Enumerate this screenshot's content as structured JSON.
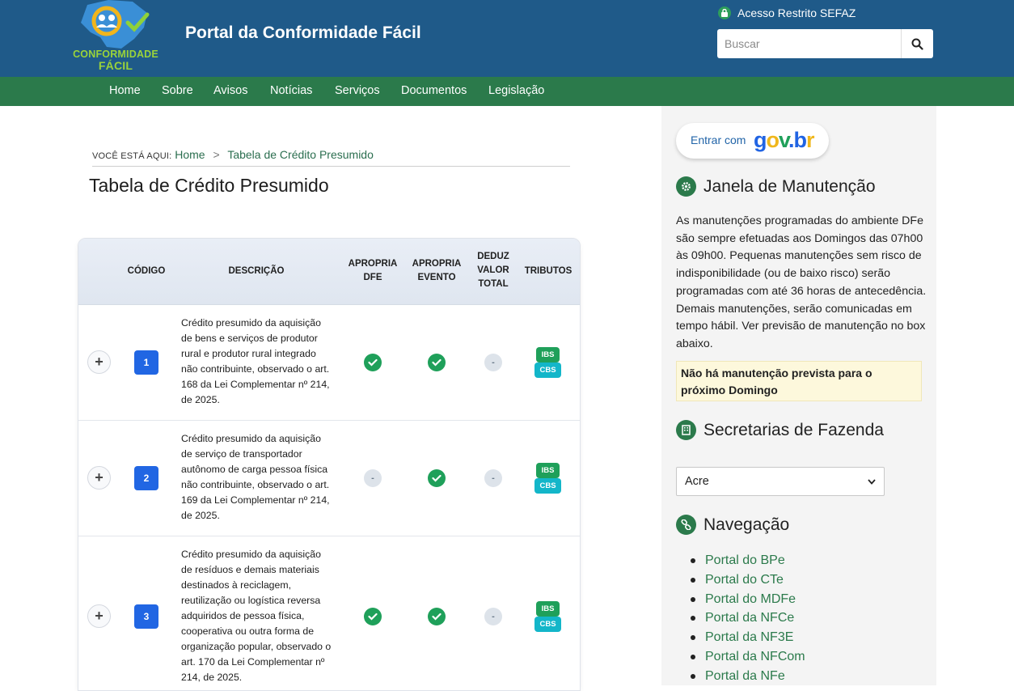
{
  "header": {
    "logo_text_1": "CONFORMIDADE",
    "logo_text_2": "FÁCIL",
    "site_title": "Portal da Conformidade Fácil",
    "restricted_label": "Acesso Restrito SEFAZ",
    "search_placeholder": "Buscar"
  },
  "nav": {
    "items": [
      "Home",
      "Sobre",
      "Avisos",
      "Notícias",
      "Serviços",
      "Documentos",
      "Legislação"
    ]
  },
  "breadcrumb": {
    "label": "VOCÊ ESTÁ AQUI:",
    "home": "Home",
    "separator": ">",
    "current": "Tabela de Crédito Presumido"
  },
  "page_title": "Tabela de Crédito Presumido",
  "table": {
    "headers": {
      "codigo": "CÓDIGO",
      "descricao": "DESCRIÇÃO",
      "apropria_dfe": "APROPRIA DFE",
      "apropria_evento": "APROPRIA EVENTO",
      "deduz_valor_total": "DEDUZ VALOR TOTAL",
      "tributos": "TRIBUTOS"
    },
    "expand_symbol": "+",
    "dash_symbol": "-",
    "rows": [
      {
        "code": "1",
        "description": "Crédito presumido da aquisição de bens e serviços de produtor rural e produtor rural integrado não contribuinte, observado o art. 168 da Lei Complementar nº 214, de 2025.",
        "apropria_dfe": true,
        "apropria_evento": true,
        "deduz_valor_total": false,
        "tributos": [
          "IBS",
          "CBS"
        ]
      },
      {
        "code": "2",
        "description": "Crédito presumido da aquisição de serviço de transportador autônomo de carga pessoa física não contribuinte, observado o art. 169 da Lei Complementar nº 214, de 2025.",
        "apropria_dfe": false,
        "apropria_evento": true,
        "deduz_valor_total": false,
        "tributos": [
          "IBS",
          "CBS"
        ]
      },
      {
        "code": "3",
        "description": "Crédito presumido da aquisição de resíduos e demais materiais destinados à reciclagem, reutilização ou logística reversa adquiridos de pessoa física, cooperativa ou outra forma de organização popular, observado o art. 170 da Lei Complementar nº 214, de 2025.",
        "apropria_dfe": true,
        "apropria_evento": true,
        "deduz_valor_total": false,
        "tributos": [
          "IBS",
          "CBS"
        ]
      }
    ]
  },
  "sidebar": {
    "govbr_label": "Entrar com",
    "govbr_logo": "gov.br",
    "maintenance": {
      "title": "Janela de Manutenção",
      "text": "As manutenções programadas do ambiente DFe são sempre efetuadas aos Domingos das 07h00 às 09h00. Pequenas manutenções sem risco de indisponibilidade (ou de baixo risco) serão programadas com até 36 horas de antecedência. Demais manutenções, serão comunicadas em tempo hábil. Ver previsão de manutenção no box abaixo.",
      "note": "Não há manutenção prevista para o próximo Domingo"
    },
    "secretarias": {
      "title": "Secretarias de Fazenda",
      "selected": "Acre"
    },
    "navegacao": {
      "title": "Navegação",
      "links": [
        "Portal do BPe",
        "Portal do CTe",
        "Portal do MDFe",
        "Portal da NFCe",
        "Portal da NF3E",
        "Portal da NFCom",
        "Portal da NFe"
      ]
    }
  },
  "colors": {
    "header_blue": "#1f5a89",
    "nav_green": "#2b7a4b",
    "code_blue": "#2166e3",
    "ok_green": "#1fa05a",
    "cbs_cyan": "#13b6c9"
  }
}
